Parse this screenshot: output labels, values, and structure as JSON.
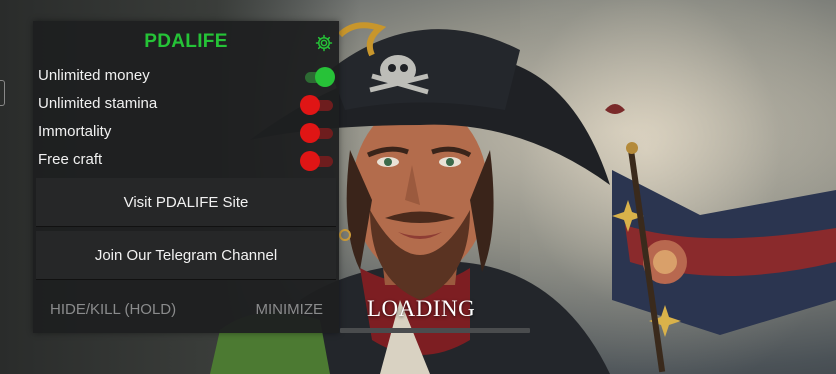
{
  "menu": {
    "title": "PDALIFE",
    "title_color": "#25c337",
    "settings_icon": "gear-icon",
    "toggles": [
      {
        "label": "Unlimited money",
        "state": "on"
      },
      {
        "label": "Unlimited stamina",
        "state": "off"
      },
      {
        "label": "Immortality",
        "state": "off"
      },
      {
        "label": "Free craft",
        "state": "off"
      }
    ],
    "visit_button": "Visit PDALIFE Site",
    "telegram_button": "Join Our Telegram Channel",
    "hide_button": "HIDE/KILL (HOLD)",
    "minimize_button": "MINIMIZE"
  },
  "game": {
    "loading_text": "LOADING",
    "loading_progress": 0
  },
  "colors": {
    "toggle_on": "#27c238",
    "toggle_off": "#e01515"
  }
}
